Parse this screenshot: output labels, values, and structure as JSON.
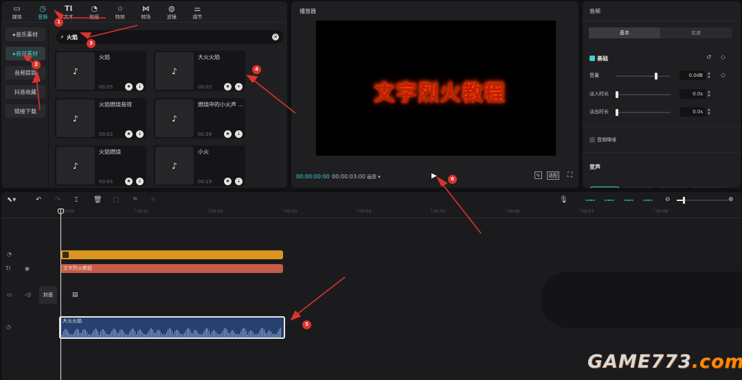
{
  "top_tabs": [
    {
      "label": "媒体",
      "icon": "media-icon"
    },
    {
      "label": "音频",
      "icon": "audio-icon"
    },
    {
      "label": "文本",
      "icon": "text-icon"
    },
    {
      "label": "贴纸",
      "icon": "sticker-icon"
    },
    {
      "label": "特效",
      "icon": "effects-icon"
    },
    {
      "label": "转场",
      "icon": "transition-icon"
    },
    {
      "label": "滤镜",
      "icon": "filter-icon"
    },
    {
      "label": "调节",
      "icon": "adjust-icon"
    }
  ],
  "active_tab": "音频",
  "categories": [
    "音乐素材",
    "音效素材",
    "音频提取",
    "抖音收藏",
    "链接下载"
  ],
  "search": {
    "value": "火焰"
  },
  "sounds": [
    {
      "title": "火焰",
      "duration": "00:05"
    },
    {
      "title": "大火火焰",
      "duration": "00:03"
    },
    {
      "title": "火焰燃烧音效",
      "duration": "00:03"
    },
    {
      "title": "燃烧中的小火声 ...",
      "duration": "00:39"
    },
    {
      "title": "火焰燃烧",
      "duration": "00:03"
    },
    {
      "title": "小火",
      "duration": "00:19"
    }
  ],
  "player": {
    "title": "播放器",
    "preview_text": "文字烈火教程",
    "current_time": "00:00:00:00",
    "total_time": "00:00:03:00",
    "quality": "画质",
    "ratio_label": "适配"
  },
  "props": {
    "title": "音频",
    "subtabs": [
      "基本",
      "变速"
    ],
    "section": "基础",
    "volume_label": "音量",
    "volume_value": "0.0dB",
    "volume_level": 0.75,
    "fadein_label": "淡入时长",
    "fadein_value": "0.0s",
    "fadeout_label": "淡出时长",
    "fadeout_value": "0.0s",
    "denoise_label": "音频降噪",
    "voice_section": "变声"
  },
  "timeline": {
    "ruler": [
      "00:00",
      "00:01",
      "00:02",
      "00:03",
      "00:04",
      "00:05",
      "00:06",
      "00:07",
      "00:08"
    ],
    "text_clip": "文字烈火教程",
    "cover_label": "封面",
    "audio_clip": "大火火焰"
  },
  "annotations": [
    "1",
    "2",
    "3",
    "4",
    "5",
    "6"
  ],
  "watermark": {
    "main": "GAME773",
    "suffix": ".com"
  },
  "colors": {
    "accent": "#3ecfd9",
    "text_clip": "#c65b46",
    "sticker_clip": "#d9961f",
    "audio_clip": "#26406f",
    "annotation": "#e0332d"
  }
}
